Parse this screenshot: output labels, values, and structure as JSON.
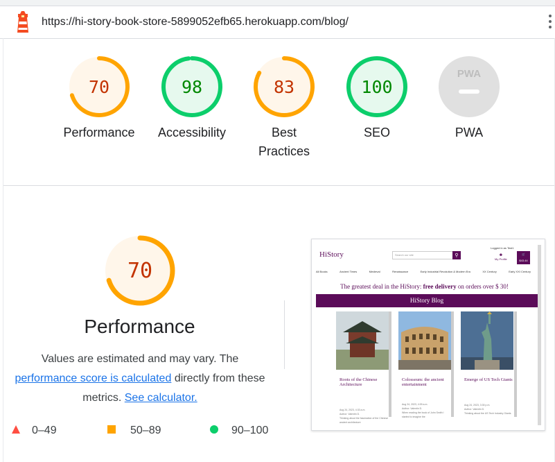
{
  "browser": {
    "url": "https://hi-story-book-store-5899052efb65.herokuapp.com/blog/"
  },
  "scores": [
    {
      "value": "70",
      "label": "Performance",
      "fraction": 0.7,
      "status": "average"
    },
    {
      "value": "98",
      "label": "Accessibility",
      "fraction": 0.98,
      "status": "pass"
    },
    {
      "value": "83",
      "label": "Best\nPractices",
      "fraction": 0.83,
      "status": "average"
    },
    {
      "value": "100",
      "label": "SEO",
      "fraction": 1.0,
      "status": "pass"
    },
    {
      "value": "",
      "label": "PWA",
      "fraction": 0,
      "status": "na",
      "badge": "PWA"
    }
  ],
  "colors": {
    "pass": "#0cce6b",
    "average": "#ffa400",
    "fail": "#ff4e42",
    "pass_text": "#008800",
    "average_text": "#c33300",
    "link": "#1a73e8"
  },
  "performance": {
    "score": "70",
    "title": "Performance",
    "desc_prefix": "Values are estimated and may vary. The",
    "desc_link1": "performance score is calculated",
    "desc_middle": "directly from these metrics.",
    "desc_link2": "See calculator."
  },
  "legend": [
    {
      "range": "0–49",
      "shape": "triangle-icon"
    },
    {
      "range": "50–89",
      "shape": "square-icon"
    },
    {
      "range": "90–100",
      "shape": "circle-icon"
    }
  ],
  "screenshot": {
    "brand": "HiStory",
    "search_placeholder": "Search our site",
    "logged_in": "Logged in as Test1",
    "profile": "My Profile",
    "bag_total": "$43.44",
    "nav": [
      "All Books",
      "Ancient Times",
      "Medieval",
      "Renaissance",
      "Early Industrial Revolution & Modern Era",
      "XX Century",
      "Early XXI Century"
    ],
    "promo_prefix": "The greatest deal in the HiStory:",
    "promo_bold": "free delivery",
    "promo_suffix": "on orders over $ 30!",
    "blog_header": "HiStory Blog",
    "cards": [
      {
        "title": "Roots of the Chinese Architecture",
        "date": "Aug 24, 2023, 4:33 a.m.",
        "author": "Author: Valentin D.",
        "excerpt": "Thinking about the fascination of the Chinese ancient architecture"
      },
      {
        "title": "Colosseum: the ancient entertainment",
        "date": "Aug 24, 2023, 4:09 a.m.",
        "author": "Author: Valentin D.",
        "excerpt": "When reading the book of John Smith I started to imagine the"
      },
      {
        "title": "Emerge of US Tech Giants",
        "date": "Aug 24, 2023, 3:30 p.m.",
        "author": "Author: Valentin D.",
        "excerpt": "Thinking about the US Tech Industry Giants"
      }
    ]
  }
}
